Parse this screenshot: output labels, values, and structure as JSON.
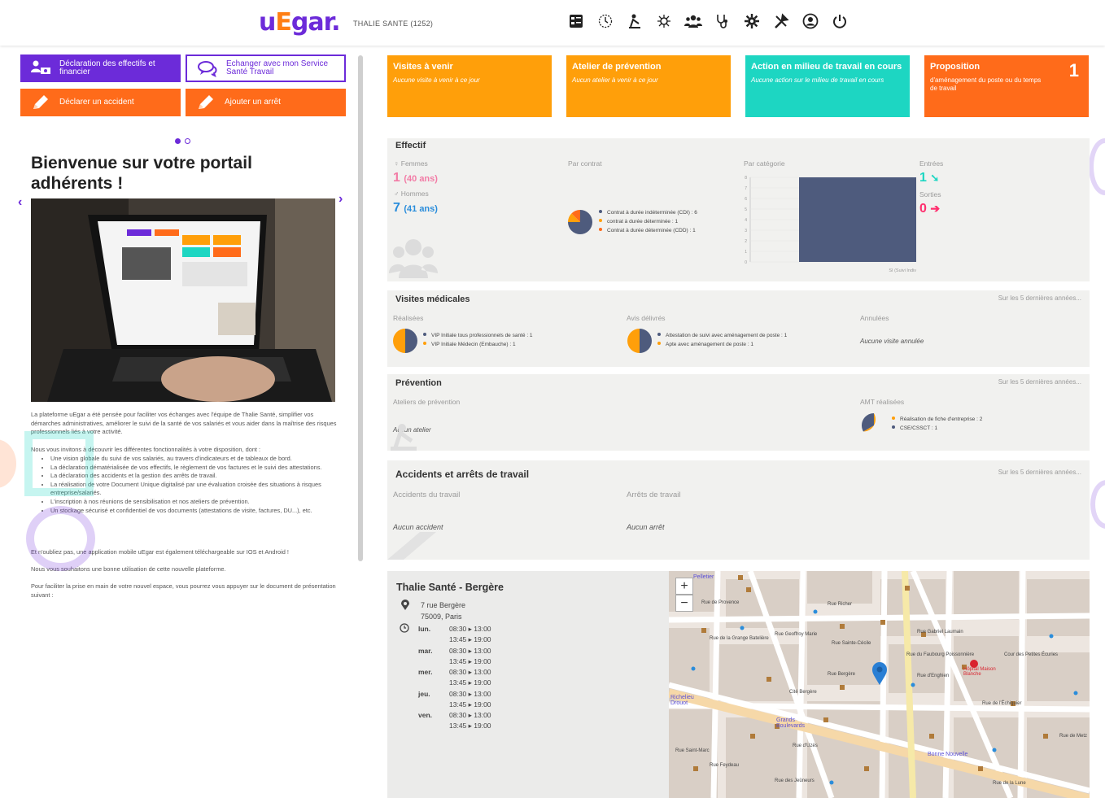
{
  "header": {
    "logo_u": "u",
    "logo_e": "E",
    "logo_rest": "gar.",
    "org_name": "THALIE SANTE (1252)",
    "nav_icons": [
      "dashboard-icon",
      "history-icon",
      "person-icon",
      "virus-icon",
      "team-icon",
      "stethoscope-icon",
      "settings-icon",
      "tools-icon",
      "account-icon",
      "power-icon"
    ]
  },
  "quick_actions": {
    "declare_workforce": "Déclaration des effectifs et financier",
    "contact_service": "Echanger avec mon Service Santé Travail",
    "declare_accident": "Déclarer un accident",
    "add_stop": "Ajouter un arrêt"
  },
  "carousel": {
    "title": "Bienvenue sur votre portail adhérents !",
    "intro": "La plateforme uEgar a été pensée pour faciliter vos échanges avec l'équipe de Thalie Santé, simplifier vos démarches administratives, améliorer le suivi de la santé de vos salariés et vous aider dans la maîtrise des risques professionnels liés à votre activité.",
    "invite": "Nous vous invitons à découvrir les différentes fonctionnalités à votre disposition, dont :",
    "features": [
      "Une vision globale du suivi de vos salariés, au travers d'indicateurs et de tableaux de bord.",
      "La déclaration dématérialisée de vos effectifs, le règlement de vos factures et le suivi des attestations.",
      "La déclaration des accidents et la gestion des arrêts de travail.",
      "La réalisation de votre Document Unique digitalisé par une évaluation croisée des situations à risques entreprise/salariés.",
      "L'inscription à nos réunions de sensibilisation et nos ateliers de prévention.",
      "Un stockage sécurisé et confidentiel de vos documents (attestations de visite, factures, DU...), etc."
    ],
    "mobile": "Et n'oubliez pas, une application mobile uEgar est également téléchargeable sur IOS et Android !",
    "wish": "Nous vous souhaitons une bonne utilisation de cette nouvelle plateforme.",
    "doc": "Pour faciliter la prise en main de votre nouvel espace, vous pourrez vous appuyer sur le document de présentation suivant :"
  },
  "cards": [
    {
      "title": "Visites à venir",
      "subtitle": "Aucune visite à venir à ce jour",
      "count": "",
      "color": "#ff9f0a"
    },
    {
      "title": "Atelier de prévention",
      "subtitle": "Aucun atelier à venir à ce jour",
      "count": "",
      "color": "#ff9f0a"
    },
    {
      "title": "Action en milieu de travail en cours",
      "subtitle": "Aucune action sur le milieu de travail en cours",
      "count": "",
      "color": "#1dd6c2"
    },
    {
      "title": "Proposition",
      "subtitle": "d'aménagement du poste ou du temps de travail",
      "count": "1",
      "color": "#ff6b1a"
    }
  ],
  "effectif": {
    "title": "Effectif",
    "women_label": "Femmes",
    "women_count": "1",
    "women_age": "(40 ans)",
    "men_label": "Hommes",
    "men_count": "7",
    "men_age": "(41 ans)",
    "contract_label": "Par contrat",
    "contract_legend": [
      {
        "label": "Contrat à durée indéterminée (CDI) : 6",
        "color": "#4e5b7d"
      },
      {
        "label": "contrat à durée déterminée : 1",
        "color": "#ff9f0a"
      },
      {
        "label": "Contrat à durée déterminée (CDD) : 1",
        "color": "#ff6b1a"
      }
    ],
    "category_label": "Par catégorie",
    "entries_label": "Entrées",
    "entries_count": "1",
    "exits_label": "Sorties",
    "exits_count": "0"
  },
  "chart_data": {
    "type": "bar",
    "categories": [
      "SI (Suivi Indiv"
    ],
    "values": [
      8
    ],
    "ylim": [
      0,
      8
    ],
    "yticks": [
      "8",
      "7",
      "6",
      "5",
      "4",
      "3",
      "2",
      "1",
      "0"
    ],
    "color": "#4e5b7d"
  },
  "visits": {
    "title": "Visites médicales",
    "more": "Sur les 5 dernières années...",
    "done_label": "Réalisées",
    "done_legend": [
      {
        "label": "VIP Initiale tous professionnels de santé : 1",
        "color": "#4e5b7d"
      },
      {
        "label": "VIP Initiale Médecin (Embauche) : 1",
        "color": "#ff9f0a"
      }
    ],
    "opinions_label": "Avis délivrés",
    "opinions_legend": [
      {
        "label": "Attestation de suivi avec aménagement de poste : 1",
        "color": "#4e5b7d"
      },
      {
        "label": "Apte avec aménagement de poste : 1",
        "color": "#ff9f0a"
      }
    ],
    "cancelled_label": "Annulées",
    "cancelled_empty": "Aucune visite annulée"
  },
  "prevention": {
    "title": "Prévention",
    "more": "Sur les 5 dernières années...",
    "workshops_label": "Ateliers de prévention",
    "workshops_empty": "Aucun atelier",
    "amt_label": "AMT réalisées",
    "amt_legend": [
      {
        "label": "Réalisation de fiche d'entreprise : 2",
        "color": "#ff9f0a"
      },
      {
        "label": "CSE/CSSCT : 1",
        "color": "#4e5b7d"
      }
    ]
  },
  "accidents": {
    "title": "Accidents et arrêts de travail",
    "more": "Sur les 5 dernières années...",
    "accidents_label": "Accidents du travail",
    "accidents_empty": "Aucun accident",
    "stops_label": "Arrêts de travail",
    "stops_empty": "Aucun arrêt"
  },
  "contact": {
    "name": "Thalie Santé - Bergère",
    "street": "7 rue Bergère",
    "city": "75009, Paris",
    "hours": [
      {
        "day": "lun.",
        "a1": "08:30",
        "a2": "13:00",
        "b1": "13:45",
        "b2": "19:00"
      },
      {
        "day": "mar.",
        "a1": "08:30",
        "a2": "13:00",
        "b1": "13:45",
        "b2": "19:00"
      },
      {
        "day": "mer.",
        "a1": "08:30",
        "a2": "13:00",
        "b1": "13:45",
        "b2": "19:00"
      },
      {
        "day": "jeu.",
        "a1": "08:30",
        "a2": "13:00",
        "b1": "13:45",
        "b2": "19:00"
      },
      {
        "day": "ven.",
        "a1": "08:30",
        "a2": "13:00",
        "b1": "13:45",
        "b2": "19:00"
      }
    ]
  },
  "map": {
    "zoom_in": "+",
    "zoom_out": "−",
    "labels": [
      "Pelletier",
      "Rue de Provence",
      "Rue Richer",
      "Rue de la Grange Batelière",
      "Rue Geoffroy Marie",
      "Rue Sainte-Cécile",
      "Rue Bergère",
      "Cité Bergère",
      "Rue d'Enghien",
      "Hôpital Maison Blanche",
      "Rue de l'Échiquier",
      "Grands Boulevards",
      "Rue d'Uzès",
      "Bonne Nouvelle",
      "Rue Saint-Marc",
      "Rue Feydeau",
      "Rue Gabriel Laumain",
      "Cour des Petites Écuries",
      "Rue de la Lune",
      "Rue du Faubourg Poissonnière",
      "Richelieu Drouot",
      "Rue des Jeûneurs",
      "Rue de Metz"
    ]
  }
}
